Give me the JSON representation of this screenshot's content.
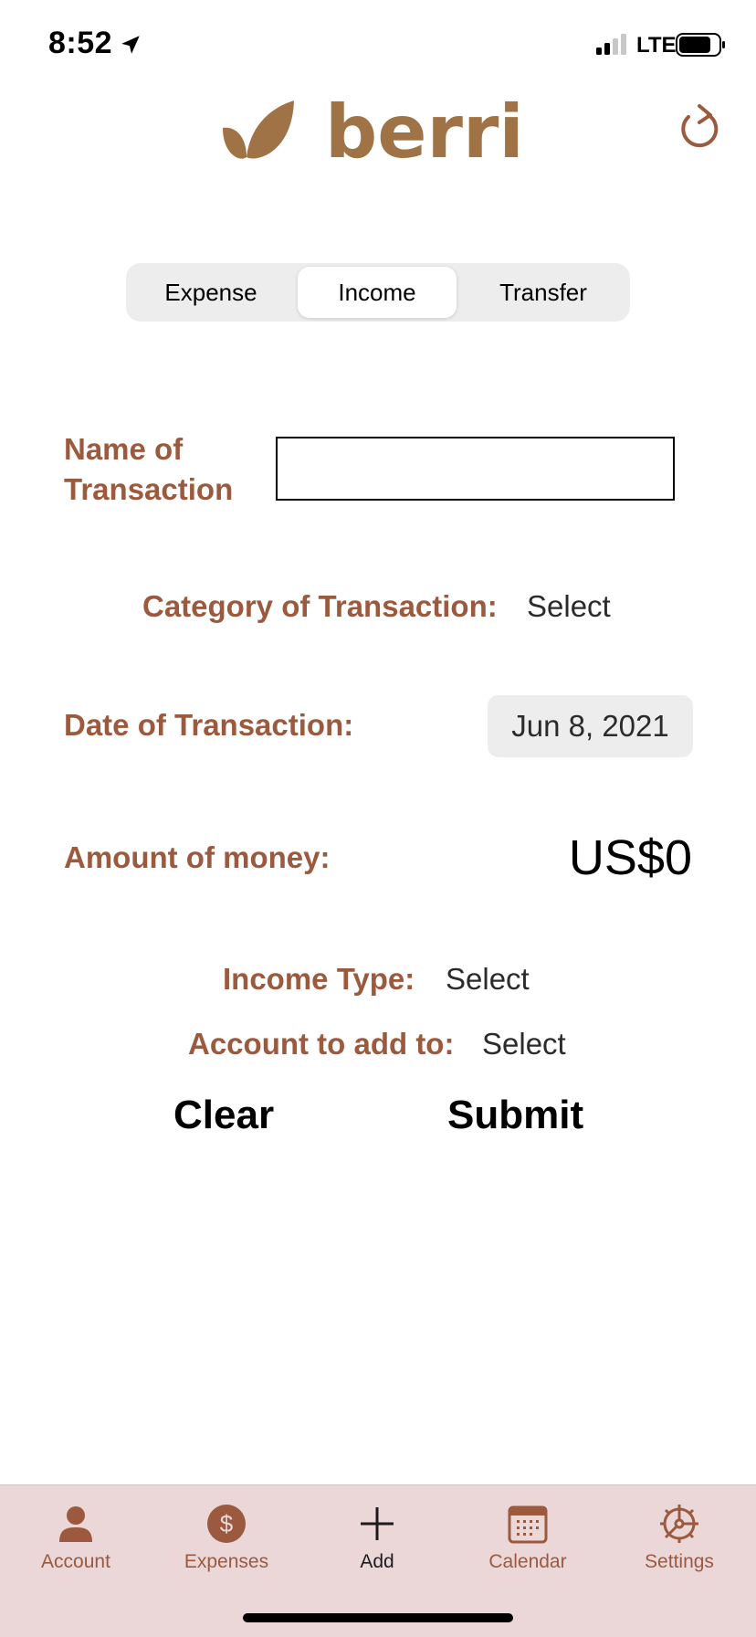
{
  "status_bar": {
    "time": "8:52",
    "network": "LTE",
    "location_icon": "location-arrow-icon",
    "signal_icon": "signal-bars-icon",
    "battery_icon": "battery-icon"
  },
  "header": {
    "logo_text": "berri",
    "logo_icon": "leaf-icon",
    "refresh_icon": "refresh-icon",
    "brand_color": "#9b5a3e"
  },
  "segments": {
    "items": [
      "Expense",
      "Income",
      "Transfer"
    ],
    "selected": "Income"
  },
  "form": {
    "name_label": "Name of Transaction",
    "name_value": "",
    "category_label": "Category of Transaction:",
    "category_value": "Select",
    "date_label": "Date of Transaction:",
    "date_value": "Jun 8, 2021",
    "amount_label": "Amount of money:",
    "amount_value": "US$0",
    "income_type_label": "Income Type:",
    "income_type_value": "Select",
    "account_label": "Account to add to:",
    "account_value": "Select"
  },
  "actions": {
    "clear_label": "Clear",
    "submit_label": "Submit"
  },
  "tab_bar": {
    "items": [
      {
        "label": "Account",
        "icon": "person-icon"
      },
      {
        "label": "Expenses",
        "icon": "dollar-circle-icon"
      },
      {
        "label": "Add",
        "icon": "plus-icon"
      },
      {
        "label": "Calendar",
        "icon": "calendar-icon"
      },
      {
        "label": "Settings",
        "icon": "gear-icon"
      }
    ],
    "selected": "Add",
    "background": "#ebd6d8"
  }
}
